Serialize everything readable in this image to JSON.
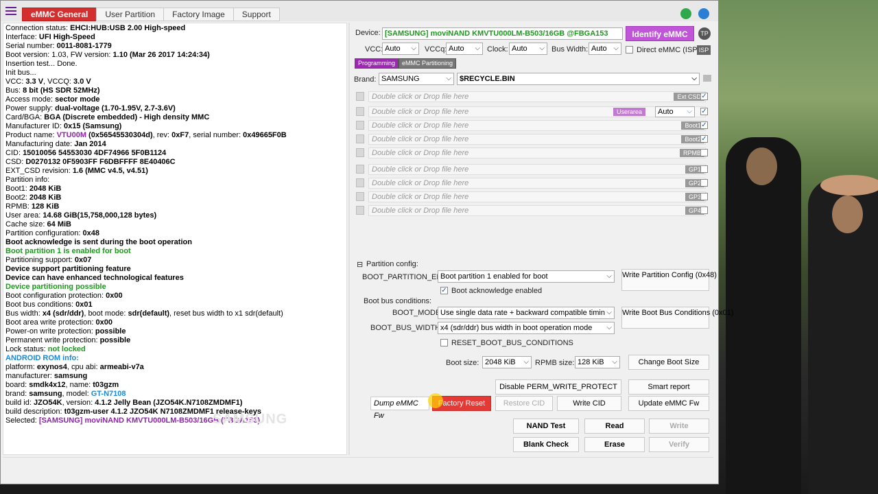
{
  "tabs": [
    "eMMC General",
    "User Partition",
    "Factory Image",
    "Support"
  ],
  "log": [
    [
      [
        "Connection status: ",
        ""
      ],
      [
        "EHCI:HUB:USB 2.00 High-speed",
        "b"
      ]
    ],
    [
      [
        "Interface: ",
        ""
      ],
      [
        "UFI High-Speed",
        "b"
      ]
    ],
    [
      [
        "Serial number: ",
        ""
      ],
      [
        "0011-8081-1779",
        "b"
      ]
    ],
    [
      [
        " Boot version: ",
        ""
      ],
      [
        "1.03",
        ""
      ],
      [
        ", FW version: ",
        ""
      ],
      [
        "1.10 (Mar 26 2017 14:24:34)",
        "b"
      ]
    ],
    [
      [
        "Insertion test... Done.",
        ""
      ]
    ],
    [
      [
        "Init bus...",
        ""
      ]
    ],
    [
      [
        "VCC: ",
        ""
      ],
      [
        "3.3 V",
        "b"
      ],
      [
        ", VCCQ: ",
        ""
      ],
      [
        "3.0 V",
        "b"
      ]
    ],
    [
      [
        "Bus: ",
        ""
      ],
      [
        "8 bit (HS SDR 52MHz)",
        "b"
      ]
    ],
    [
      [
        "Access mode: ",
        ""
      ],
      [
        "sector mode",
        "b"
      ]
    ],
    [
      [
        "Power supply: ",
        ""
      ],
      [
        "dual-voltage (1.70-1.95V, 2.7-3.6V)",
        "b"
      ]
    ],
    [
      [
        " Card/BGA: ",
        ""
      ],
      [
        "BGA (Discrete embedded) - High density MMC",
        "b"
      ]
    ],
    [
      [
        " Manufacturer ID: ",
        ""
      ],
      [
        "0x15 (Samsung)",
        "b"
      ]
    ],
    [
      [
        " Product name: ",
        ""
      ],
      [
        "VTU00M",
        "pu"
      ],
      [
        " (0x56545530304d)",
        "b"
      ],
      [
        ", rev: ",
        ""
      ],
      [
        "0xF7",
        "b"
      ],
      [
        ", serial number: ",
        ""
      ],
      [
        "0x49665F0B",
        "b"
      ]
    ],
    [
      [
        " Manufacturing date: ",
        ""
      ],
      [
        "Jan 2014",
        "b"
      ]
    ],
    [
      [
        "CID: ",
        ""
      ],
      [
        "15010056 54553030 4DF74966 5F0B1124",
        "b"
      ]
    ],
    [
      [
        "CSD: ",
        ""
      ],
      [
        "D0270132 0F5903FF F6DBFFFF 8E40406C",
        "b"
      ]
    ],
    [
      [
        "EXT_CSD revision: ",
        ""
      ],
      [
        "1.6 (MMC v4.5, v4.51)",
        "b"
      ]
    ],
    [
      [
        "Partition info:",
        ""
      ]
    ],
    [
      [
        " Boot1: ",
        ""
      ],
      [
        "2048 KiB",
        "b"
      ]
    ],
    [
      [
        " Boot2: ",
        ""
      ],
      [
        "2048 KiB",
        "b"
      ]
    ],
    [
      [
        " RPMB: ",
        ""
      ],
      [
        "128 KiB",
        "b"
      ]
    ],
    [
      [
        " User area: ",
        ""
      ],
      [
        "14.68 GiB(15,758,000,128 bytes)",
        "b"
      ]
    ],
    [
      [
        "Cache size: ",
        ""
      ],
      [
        "64 MiB",
        "b"
      ]
    ],
    [
      [
        "Partition configuration: ",
        ""
      ],
      [
        "0x48",
        "b"
      ]
    ],
    [
      [
        " Boot acknowledge is sent during the boot operation",
        "b"
      ]
    ],
    [
      [
        " Boot partition 1 is enabled for boot",
        "g"
      ]
    ],
    [
      [
        "Partitioning support: ",
        ""
      ],
      [
        "0x07",
        "b"
      ]
    ],
    [
      [
        " Device support partitioning feature",
        "b"
      ]
    ],
    [
      [
        " Device can have enhanced technological features",
        "b"
      ]
    ],
    [
      [
        " Device partitioning possible",
        "g"
      ]
    ],
    [
      [
        "Boot configuration protection: ",
        ""
      ],
      [
        "0x00",
        "b"
      ]
    ],
    [
      [
        "Boot bus conditions: ",
        ""
      ],
      [
        "0x01",
        "b"
      ]
    ],
    [
      [
        " Bus width: ",
        ""
      ],
      [
        "x4 (sdr/ddr)",
        "b"
      ],
      [
        ", boot mode: ",
        ""
      ],
      [
        "sdr(default)",
        "b"
      ],
      [
        ", reset bus width to x1 sdr(default)",
        ""
      ]
    ],
    [
      [
        "Boot area write protection: ",
        ""
      ],
      [
        "0x00",
        "b"
      ]
    ],
    [
      [
        " Power-on write protection: ",
        ""
      ],
      [
        "possible",
        "b"
      ]
    ],
    [
      [
        " Permanent write protection: ",
        ""
      ],
      [
        "possible",
        "b"
      ]
    ],
    [
      [
        " Lock status: ",
        ""
      ],
      [
        "not locked",
        "g"
      ]
    ],
    [
      [
        " ",
        ""
      ]
    ],
    [
      [
        "ANDROID ROM info:",
        "bl"
      ]
    ],
    [
      [
        " platform: ",
        ""
      ],
      [
        "exynos4",
        "b"
      ],
      [
        ", cpu abi: ",
        ""
      ],
      [
        "armeabi-v7a",
        "b"
      ]
    ],
    [
      [
        " manufacturer: ",
        ""
      ],
      [
        "samsung",
        "b"
      ]
    ],
    [
      [
        " board: ",
        ""
      ],
      [
        "smdk4x12",
        "b"
      ],
      [
        ", name: ",
        ""
      ],
      [
        "t03gzm",
        "b"
      ]
    ],
    [
      [
        " brand: ",
        ""
      ],
      [
        "samsung",
        "b"
      ],
      [
        ", model: ",
        ""
      ],
      [
        "GT-N7108",
        "bl"
      ]
    ],
    [
      [
        " build id: ",
        ""
      ],
      [
        "JZO54K",
        "b"
      ],
      [
        ", version: ",
        ""
      ],
      [
        "4.1.2 Jelly Bean (JZO54K.N7108ZMDMF1)",
        "b"
      ]
    ],
    [
      [
        " build description: ",
        ""
      ],
      [
        "t03gzm-user 4.1.2 JZO54K N7108ZMDMF1 release-keys",
        "b"
      ]
    ],
    [
      [
        " ",
        ""
      ]
    ],
    [
      [
        "Selected: ",
        ""
      ],
      [
        "[SAMSUNG] moviNAND KMVTU000LM-B503/16GB  (FBGA153)",
        "pu"
      ]
    ]
  ],
  "watermark": "SAMSUNG",
  "device": {
    "label": "Device:",
    "value": "[SAMSUNG] moviNAND KMVTU000LM-B503/16GB @FBGA153",
    "identify_label": "Identify eMMC",
    "tp_label": "TP"
  },
  "power": {
    "vcc_label": "VCC:",
    "vcc_value": "Auto",
    "vccq_label": "VCCq:",
    "vccq_value": "Auto",
    "clock_label": "Clock:",
    "clock_value": "Auto",
    "bus_label": "Bus Width:",
    "bus_value": "Auto",
    "direct_label": "Direct eMMC (ISP)",
    "isp_label": "ISP"
  },
  "subtabs": [
    "Programming",
    "eMMC Partitioning"
  ],
  "brand": {
    "label": "Brand:",
    "value": "SAMSUNG",
    "file": "$RECYCLE.BIN"
  },
  "file_rows": [
    {
      "placeholder": "Double click or Drop file here",
      "tag": "Ext CSD",
      "checked": true
    },
    {
      "placeholder": "Double click or Drop file here",
      "tag": "Userarea",
      "mode": "Auto",
      "checked": true
    },
    {
      "placeholder": "Double click or Drop file here",
      "tag": "Boot1",
      "checked": true
    },
    {
      "placeholder": "Double click or Drop file here",
      "tag": "Boot2",
      "checked": true
    },
    {
      "placeholder": "Double click or Drop file here",
      "tag": "RPMB",
      "checked": false
    },
    {
      "placeholder": "Double click or Drop file here",
      "tag": "GP1",
      "checked": false
    },
    {
      "placeholder": "Double click or Drop file here",
      "tag": "GP2",
      "checked": false
    },
    {
      "placeholder": "Double click or Drop file here",
      "tag": "GP3",
      "checked": false
    },
    {
      "placeholder": "Double click or Drop file here",
      "tag": "GP4",
      "checked": false
    }
  ],
  "partition": {
    "header": "Partition config:",
    "boot_partition_label": "BOOT_PARTITION_EN",
    "boot_partition_value": "Boot partition 1 enabled for boot",
    "write_config_label": "Write Partition Config (0x48)",
    "boot_ack_label": "Boot acknowledge enabled",
    "bus_conditions_label": "Boot bus conditions:",
    "boot_mode_label": "BOOT_MODE",
    "boot_mode_value": "Use single data rate + backward compatible timin",
    "write_bus_label": "Write Boot Bus Conditions (0x01)",
    "bus_width_label": "BOOT_BUS_WIDTH",
    "bus_width_value": "x4 (sdr/ddr) bus width in boot operation mode",
    "reset_label": "RESET_BOOT_BUS_CONDITIONS"
  },
  "sizes": {
    "boot_label": "Boot size:",
    "boot_value": "2048 KiB",
    "rpmb_label": "RPMB size:",
    "rpmb_value": "128 KiB",
    "change_label": "Change Boot Size"
  },
  "actions": {
    "disable_perm": "Disable PERM_WRITE_PROTECT",
    "smart_report": "Smart report",
    "dump_fw": "Dump eMMC Fw",
    "factory_reset": "Factory Reset",
    "restore_cid": "Restore CID",
    "write_cid": "Write CID",
    "update_fw": "Update eMMC Fw",
    "nand_test": "NAND Test",
    "read": "Read",
    "write": "Write",
    "blank_check": "Blank Check",
    "erase": "Erase",
    "verify": "Verify"
  }
}
